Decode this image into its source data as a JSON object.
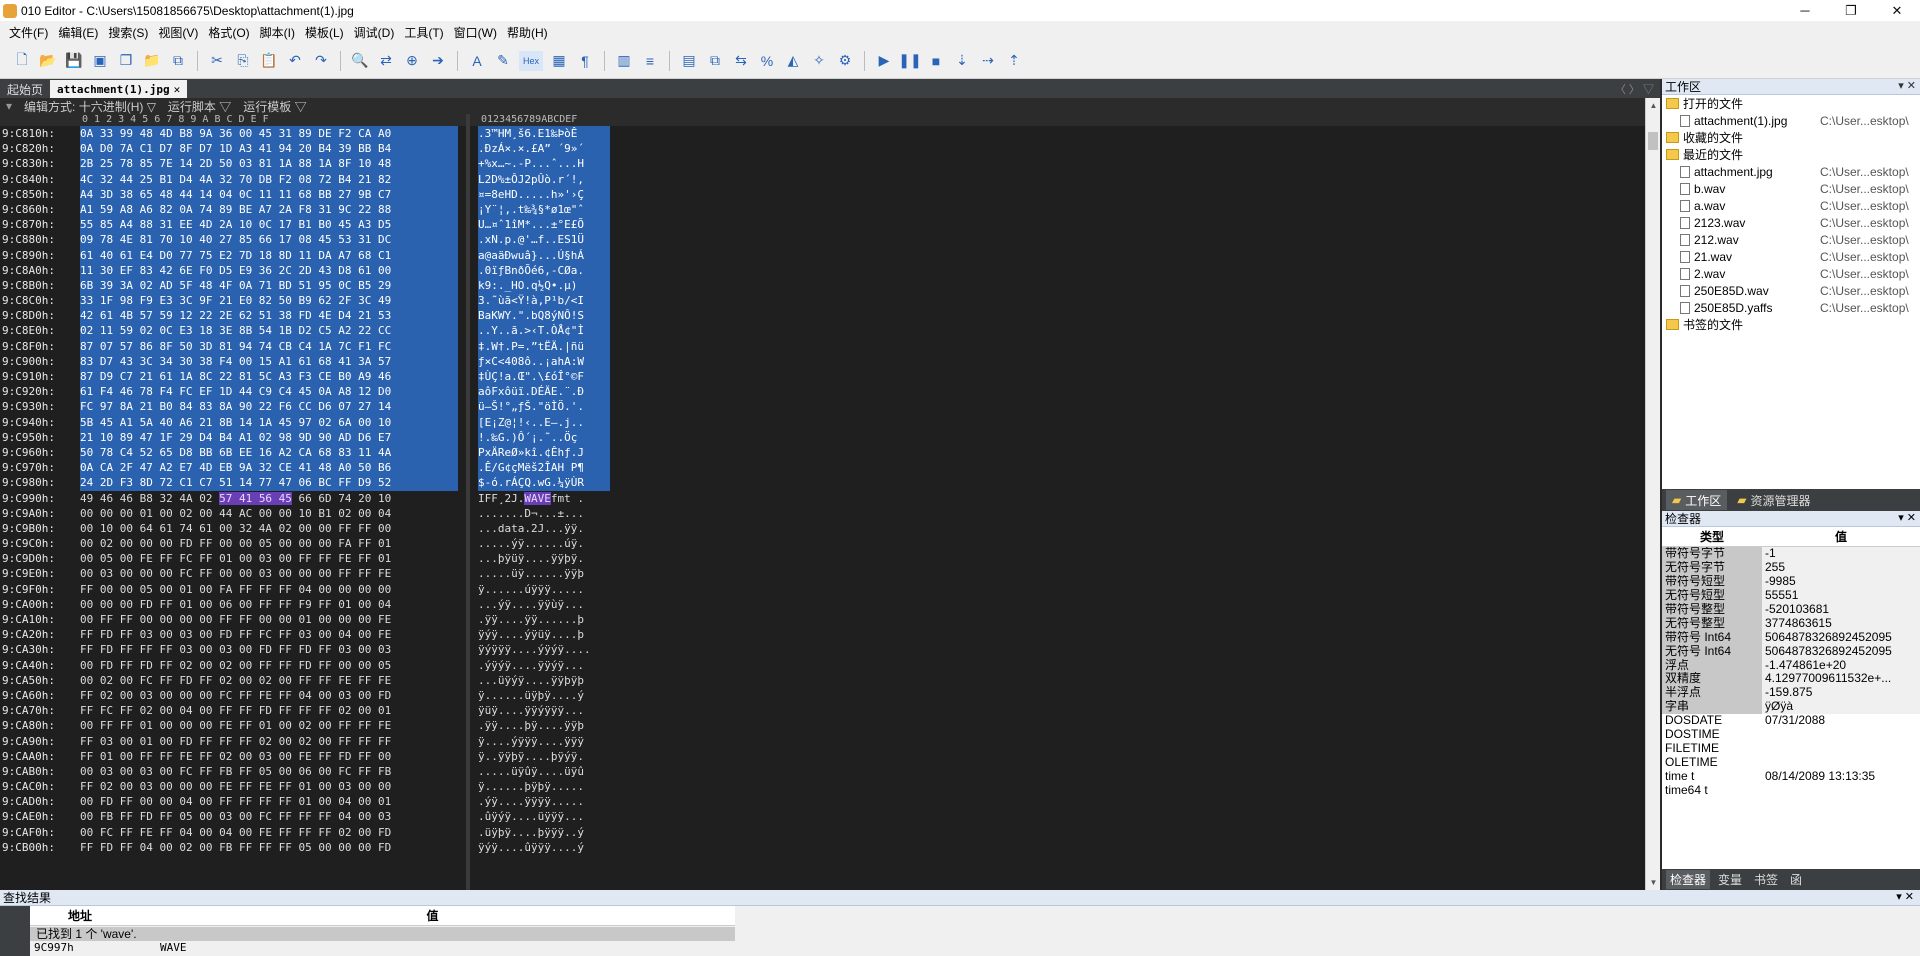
{
  "window": {
    "title": "010 Editor - C:\\Users\\15081856675\\Desktop\\attachment(1).jpg",
    "controls": [
      "─",
      "❐",
      "✕"
    ]
  },
  "menu": [
    "文件(F)",
    "编辑(E)",
    "搜索(S)",
    "视图(V)",
    "格式(O)",
    "脚本(I)",
    "模板(L)",
    "调试(D)",
    "工具(T)",
    "窗口(W)",
    "帮助(H)"
  ],
  "tabs": {
    "start": "起始页",
    "active": "attachment(1).jpg",
    "close": "✕",
    "nav": "〈 〉 ▽"
  },
  "subbar": {
    "edit_mode": "编辑方式: 十六进制(H) ▽",
    "run_script": "运行脚本 ▽",
    "run_template": "运行模板 ▽"
  },
  "hex": {
    "col_header": "0  1  2  3  4  5  6  7  8  9  A  B  C  D  E  F",
    "ascii_header": "0123456789ABCDEF",
    "rows": [
      {
        "addr": "9:C810h:",
        "hex": "0A 33 99 48 4D B8 9A 36 00 45 31 89 DE F2 CA A0",
        "asc": ".3™HM¸š6.E1‰ÞòÊ ",
        "sel": true
      },
      {
        "addr": "9:C820h:",
        "hex": "0A D0 7A C1 D7 8F D7 1D A3 41 94 20 B4 39 BB B4",
        "asc": ".ÐzÁ×.×.£A” ´9»´",
        "sel": true
      },
      {
        "addr": "9:C830h:",
        "hex": "2B 25 78 85 7E 14 2D 50 03 81 1A 88 1A 8F 10 48",
        "asc": "+%x…~.-P...ˆ...H",
        "sel": true
      },
      {
        "addr": "9:C840h:",
        "hex": "4C 32 44 25 B1 D4 4A 32 70 DB F2 08 72 B4 21 82",
        "asc": "L2D%±ÔJ2pÛò.r´!‚",
        "sel": true
      },
      {
        "addr": "9:C850h:",
        "hex": "A4 3D 38 65 48 44 14 04 0C 11 11 68 BB 27 9B C7",
        "asc": "¤=8eHD.....h»'›Ç",
        "sel": true
      },
      {
        "addr": "9:C860h:",
        "hex": "A1 59 A8 A6 82 0A 74 89 BE A7 2A F8 31 9C 22 88",
        "asc": "¡Y¨¦‚.t‰¾§*ø1œ\"ˆ",
        "sel": true
      },
      {
        "addr": "9:C870h:",
        "hex": "55 85 A4 88 31 EE 4D 2A 10 0C 17 B1 B0 45 A3 D5",
        "asc": "U…¤ˆ1îM*...±°E£Õ",
        "sel": true
      },
      {
        "addr": "9:C880h:",
        "hex": "09 78 4E 81 70 10 40 27 85 66 17 08 45 53 31 DC",
        "asc": ".xN.p.@'…f..ES1Ü",
        "sel": true
      },
      {
        "addr": "9:C890h:",
        "hex": "61 40 61 E4 D0 77 75 E2 7D 18 8D 11 DA A7 68 C1",
        "asc": "a@aäÐwuâ}...Ú§hÁ",
        "sel": true
      },
      {
        "addr": "9:C8A0h:",
        "hex": "11 30 EF 83 42 6E F0 D5 E9 36 2C 2D 43 D8 61 00",
        "asc": ".0ïƒBnðÕé6,-CØa.",
        "sel": true
      },
      {
        "addr": "9:C8B0h:",
        "hex": "6B 39 3A 02 AD 5F 48 4F 0A 71 BD 51 95 0C B5 29",
        "asc": "k9:.­_HO.q½Q•.µ)",
        "sel": true
      },
      {
        "addr": "9:C8C0h:",
        "hex": "33 1F 98 F9 E3 3C 9F 21 E0 82 50 B9 62 2F 3C 49",
        "asc": "3.˜ùã<Ÿ!à‚P¹b/<I",
        "sel": true
      },
      {
        "addr": "9:C8D0h:",
        "hex": "42 61 4B 57 59 12 22 2E 62 51 38 FD 4E D4 21 53",
        "asc": "BaKWY.\".bQ8ýNÔ!S",
        "sel": true
      },
      {
        "addr": "9:C8E0h:",
        "hex": "02 11 59 02 0C E3 18 3E 8B 54 1B D2 C5 A2 22 CC",
        "asc": "..Y..ã.>‹T.ÒÅ¢\"Ì",
        "sel": true
      },
      {
        "addr": "9:C8F0h:",
        "hex": "87 07 57 86 8F 50 3D 81 94 74 CB C4 1A 7C F1 FC",
        "asc": "‡.W†.P=.”tËÄ.|ñü",
        "sel": true
      },
      {
        "addr": "9:C900h:",
        "hex": "83 D7 43 3C 34 30 38 F4 00 15 A1 61 68 41 3A 57",
        "asc": "ƒ×C<408ô..¡ahA:W",
        "sel": true
      },
      {
        "addr": "9:C910h:",
        "hex": "87 D9 C7 21 61 1A 8C 22 81 5C A3 F3 CE B0 A9 46",
        "asc": "‡ÙÇ!a.Œ\".\\£óÎ°©F",
        "sel": true
      },
      {
        "addr": "9:C920h:",
        "hex": "61 F4 46 78 F4 FC EF 1D 44 C9 C4 45 0A A8 12 D0",
        "asc": "aôFxôüï.DÉÄE.¨.Ð",
        "sel": true
      },
      {
        "addr": "9:C930h:",
        "hex": "FC 97 8A 21 B0 84 83 8A 90 22 F6 CC D6 07 27 14",
        "asc": "ü—Š!°„ƒŠ.\"öÌÖ.'.",
        "sel": true
      },
      {
        "addr": "9:C940h:",
        "hex": "5B 45 A1 5A 40 A6 21 8B 14 1A 45 97 02 6A 00 10",
        "asc": "[E¡Z@¦!‹..E—.j..",
        "sel": true
      },
      {
        "addr": "9:C950h:",
        "hex": "21 10 89 47 1F 29 D4 B4 A1 02 98 9D 90 AD D6 E7",
        "asc": "!.‰G.)Ô´¡.˜..­Öç",
        "sel": true
      },
      {
        "addr": "9:C960h:",
        "hex": "50 78 C4 52 65 D8 BB 6B EE 16 A2 CA 68 83 11 4A",
        "asc": "PxÄReØ»kî.¢Êhƒ.J",
        "sel": true
      },
      {
        "addr": "9:C970h:",
        "hex": "0A CA 2F 47 A2 E7 4D EB 9A 32 CE 41 48 A0 50 B6",
        "asc": ".Ê/G¢çMëš2ÎAH P¶",
        "sel": true
      },
      {
        "addr": "9:C980h:",
        "hex": "24 2D F3 8D 72 C1 C7 51 14 77 47 06 BC FF D9 52",
        "asc": "$-ó.rÁÇQ.wG.¼ÿÙR",
        "sel": true
      },
      {
        "addr": "9:C990h:",
        "hex": "49 46 46 B8 32 4A 02 ",
        "hl": "57 41 56 45",
        "hex2": " 66 6D 74 20 10",
        "asc": "IFF¸2J.",
        "aschl": "WAVE",
        "asc2": "fmt .",
        "sel": false
      },
      {
        "addr": "9:C9A0h:",
        "hex": "00 00 00 01 00 02 00 44 AC 00 00 10 B1 02 00 04",
        "asc": ".......D¬...±...",
        "sel": false
      },
      {
        "addr": "9:C9B0h:",
        "hex": "00 10 00 64 61 74 61 00 32 4A 02 00 00 FF FF 00",
        "asc": "...data.2J...ÿÿ.",
        "sel": false
      },
      {
        "addr": "9:C9C0h:",
        "hex": "00 02 00 00 00 FD FF 00 00 05 00 00 00 FA FF 01",
        "asc": ".....ýÿ......úÿ.",
        "sel": false
      },
      {
        "addr": "9:C9D0h:",
        "hex": "00 05 00 FE FF FC FF 01 00 03 00 FF FF FE FF 01",
        "asc": "...þÿüÿ....ÿÿþÿ.",
        "sel": false
      },
      {
        "addr": "9:C9E0h:",
        "hex": "00 03 00 00 00 FC FF 00 00 03 00 00 00 FF FF FE",
        "asc": ".....üÿ......ÿÿþ",
        "sel": false
      },
      {
        "addr": "9:C9F0h:",
        "hex": "FF 00 00 05 00 01 00 FA FF FF FF 04 00 00 00 00",
        "asc": "ÿ......úÿÿÿ.....",
        "sel": false
      },
      {
        "addr": "9:CA00h:",
        "hex": "00 00 00 FD FF 01 00 06 00 FF FF F9 FF 01 00 04",
        "asc": "...ýÿ....ÿÿùÿ...",
        "sel": false
      },
      {
        "addr": "9:CA10h:",
        "hex": "00 FF FF 00 00 00 00 FF FF 00 00 01 00 00 00 FE",
        "asc": ".ÿÿ....ÿÿ......þ",
        "sel": false
      },
      {
        "addr": "9:CA20h:",
        "hex": "FF FD FF 03 00 03 00 FD FF FC FF 03 00 04 00 FE",
        "asc": "ÿýÿ....ýÿüÿ....þ",
        "sel": false
      },
      {
        "addr": "9:CA30h:",
        "hex": "FF FD FF FF FF 03 00 03 00 FD FF FD FF 03 00 03",
        "asc": "ÿýÿÿÿ....ýÿýÿ....",
        "sel": false
      },
      {
        "addr": "9:CA40h:",
        "hex": "00 FD FF FD FF 02 00 02 00 FF FF FD FF 00 00 05",
        "asc": ".ýÿýÿ....ÿÿýÿ...",
        "sel": false
      },
      {
        "addr": "9:CA50h:",
        "hex": "00 02 00 FC FF FD FF 02 00 02 00 FF FF FE FF FE",
        "asc": "...üÿýÿ....ÿÿþÿþ",
        "sel": false
      },
      {
        "addr": "9:CA60h:",
        "hex": "FF 02 00 03 00 00 00 FC FF FE FF 04 00 03 00 FD",
        "asc": "ÿ......üÿþÿ....ý",
        "sel": false
      },
      {
        "addr": "9:CA70h:",
        "hex": "FF FC FF 02 00 04 00 FF FF FD FF FF FF 02 00 01",
        "asc": "ÿüÿ....ÿÿýÿÿÿ...",
        "sel": false
      },
      {
        "addr": "9:CA80h:",
        "hex": "00 FF FF 01 00 00 00 FE FF 01 00 02 00 FF FF FE",
        "asc": ".ÿÿ....þÿ....ÿÿþ",
        "sel": false
      },
      {
        "addr": "9:CA90h:",
        "hex": "FF 03 00 01 00 FD FF FF FF 02 00 02 00 FF FF FF",
        "asc": "ÿ....ýÿÿÿ....ÿÿÿ",
        "sel": false
      },
      {
        "addr": "9:CAA0h:",
        "hex": "FF 01 00 FF FF FE FF 02 00 03 00 FE FF FD FF 00",
        "asc": "ÿ..ÿÿþÿ....þÿýÿ.",
        "sel": false
      },
      {
        "addr": "9:CAB0h:",
        "hex": "00 03 00 03 00 FC FF FB FF 05 00 06 00 FC FF FB",
        "asc": ".....üÿûÿ....üÿû",
        "sel": false
      },
      {
        "addr": "9:CAC0h:",
        "hex": "FF 02 00 03 00 00 00 FE FF FE FF 01 00 03 00 00",
        "asc": "ÿ......þÿþÿ.....",
        "sel": false
      },
      {
        "addr": "9:CAD0h:",
        "hex": "00 FD FF 00 00 04 00 FF FF FF FF 01 00 04 00 01",
        "asc": ".ýÿ....ÿÿÿÿ.....",
        "sel": false
      },
      {
        "addr": "9:CAE0h:",
        "hex": "00 FB FF FD FF 05 00 03 00 FC FF FF FF 04 00 03",
        "asc": ".ûÿýÿ....üÿÿÿ...",
        "sel": false
      },
      {
        "addr": "9:CAF0h:",
        "hex": "00 FC FF FE FF 04 00 04 00 FE FF FF FF 02 00 FD",
        "asc": ".üÿþÿ....þÿÿÿ..ý",
        "sel": false
      },
      {
        "addr": "9:CB00h:",
        "hex": "FF FD FF 04 00 02 00 FB FF FF FF 05 00 00 00 FD",
        "asc": "ÿýÿ....ûÿÿÿ....ý",
        "sel": false
      }
    ]
  },
  "workspace": {
    "title": "工作区",
    "open_files_label": "打开的文件",
    "open_files": [
      {
        "name": "attachment(1).jpg",
        "path": "C:\\User...esktop\\"
      }
    ],
    "favorites_label": "收藏的文件",
    "recent_label": "最近的文件",
    "recent": [
      {
        "name": "attachment.jpg",
        "path": "C:\\User...esktop\\"
      },
      {
        "name": "b.wav",
        "path": "C:\\User...esktop\\"
      },
      {
        "name": "a.wav",
        "path": "C:\\User...esktop\\"
      },
      {
        "name": "2123.wav",
        "path": "C:\\User...esktop\\"
      },
      {
        "name": "212.wav",
        "path": "C:\\User...esktop\\"
      },
      {
        "name": "21.wav",
        "path": "C:\\User...esktop\\"
      },
      {
        "name": "2.wav",
        "path": "C:\\User...esktop\\"
      },
      {
        "name": "250E85D.wav",
        "path": "C:\\User...esktop\\"
      },
      {
        "name": "250E85D.yaffs",
        "path": "C:\\User...esktop\\"
      }
    ],
    "bookmarks_label": "书签的文件",
    "tab_workspace": "工作区",
    "tab_explorer": "资源管理器"
  },
  "inspector": {
    "title": "检查器",
    "col_type": "类型",
    "col_value": "值",
    "rows": [
      {
        "k": "带符号字节",
        "v": "-1"
      },
      {
        "k": "无符号字节",
        "v": "255"
      },
      {
        "k": "带符号短型",
        "v": "-9985"
      },
      {
        "k": "无符号短型",
        "v": "55551"
      },
      {
        "k": "带符号整型",
        "v": "-520103681"
      },
      {
        "k": "无符号整型",
        "v": "3774863615"
      },
      {
        "k": "带符号 Int64",
        "v": "5064878326892452095"
      },
      {
        "k": "无符号 Int64",
        "v": "5064878326892452095"
      },
      {
        "k": "浮点",
        "v": "-1.474861e+20"
      },
      {
        "k": "双精度",
        "v": "4.12977009611532e+..."
      },
      {
        "k": "半浮点",
        "v": "-159.875"
      },
      {
        "k": "字串",
        "v": "ÿØÿà"
      },
      {
        "k": "DOSDATE",
        "v": "07/31/2088"
      },
      {
        "k": "DOSTIME",
        "v": ""
      },
      {
        "k": "FILETIME",
        "v": ""
      },
      {
        "k": "OLETIME",
        "v": ""
      },
      {
        "k": "time t",
        "v": "08/14/2089 13:13:35"
      },
      {
        "k": "time64 t",
        "v": ""
      }
    ],
    "tabs": [
      "检查器",
      "变量",
      "书签",
      "函"
    ]
  },
  "find": {
    "title": "查找结果",
    "col_addr": "地址",
    "col_value": "值",
    "summary": "已找到 1 个 'wave'.",
    "row_addr": "9C997h",
    "row_value": "WAVE"
  }
}
